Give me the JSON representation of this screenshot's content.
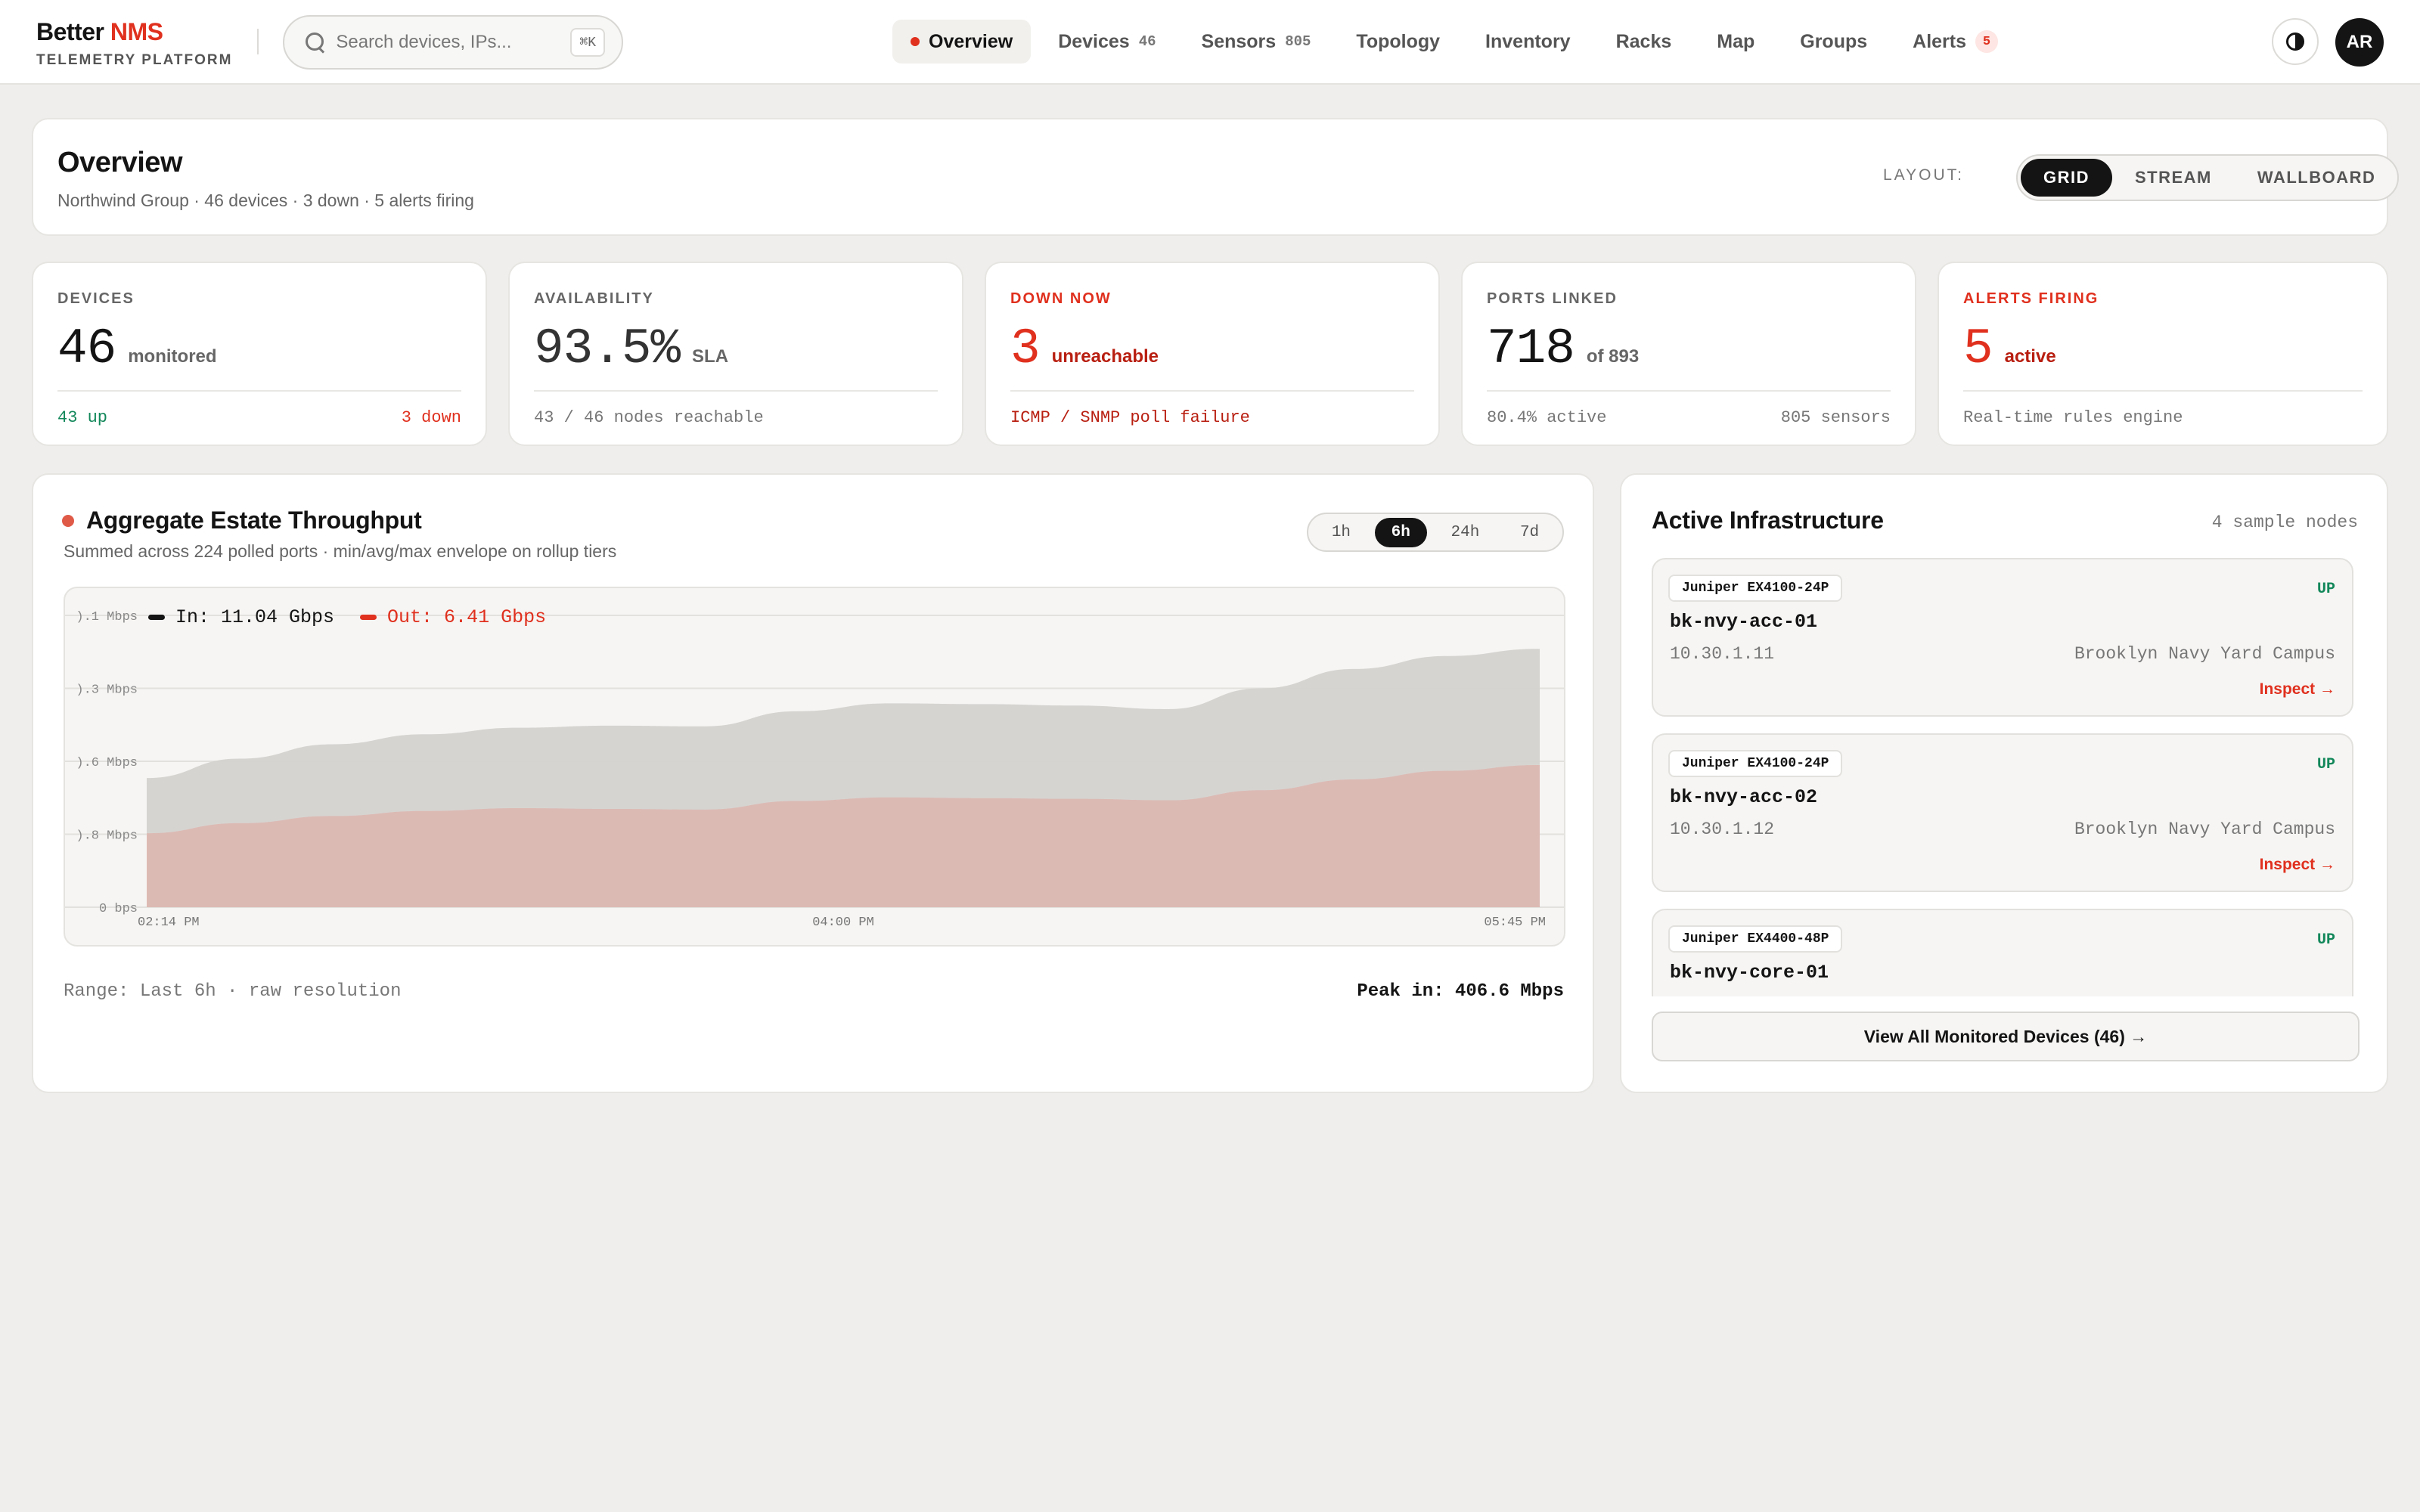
{
  "brand": {
    "name_prefix": "Better",
    "name_accent": "NMS",
    "subtitle": "TELEMETRY PLATFORM"
  },
  "search": {
    "placeholder": "Search devices, IPs...",
    "value": "",
    "shortcut": "⌘K"
  },
  "nav": {
    "items": [
      {
        "label": "Overview",
        "count": ""
      },
      {
        "label": "Devices",
        "count": "46"
      },
      {
        "label": "Sensors",
        "count": "805"
      },
      {
        "label": "Topology",
        "count": ""
      },
      {
        "label": "Inventory",
        "count": ""
      },
      {
        "label": "Racks",
        "count": ""
      },
      {
        "label": "Map",
        "count": ""
      },
      {
        "label": "Groups",
        "count": ""
      },
      {
        "label": "Alerts",
        "count": "5"
      }
    ]
  },
  "user": {
    "initials": "AR"
  },
  "overview": {
    "title": "Overview",
    "subtitle": "Northwind Group · 46 devices · 3 down · 5 alerts firing",
    "layout_label": "LAYOUT:",
    "layouts": [
      "GRID",
      "STREAM",
      "WALLBOARD"
    ],
    "active_layout": "GRID"
  },
  "stats": [
    {
      "label": "DEVICES",
      "value": "46",
      "unit": "monitored",
      "foot_left": "43 up",
      "foot_right": "3 down"
    },
    {
      "label": "AVAILABILITY",
      "value": "93.5%",
      "unit": "SLA",
      "foot_left": "43 / 46 nodes reachable",
      "foot_right": ""
    },
    {
      "label": "DOWN NOW",
      "value": "3",
      "unit": "unreachable",
      "foot_left": "ICMP / SNMP poll failure",
      "foot_right": ""
    },
    {
      "label": "PORTS LINKED",
      "value": "718",
      "unit": "of 893",
      "foot_left": "80.4% active",
      "foot_right": "805 sensors"
    },
    {
      "label": "ALERTS FIRING",
      "value": "5",
      "unit": "active",
      "foot_left": "Real-time rules engine",
      "foot_right": ""
    }
  ],
  "throughput": {
    "title": "Aggregate Estate Throughput",
    "subtitle": "Summed across 224 polled ports · min/avg/max envelope on rollup tiers",
    "ranges": [
      "1h",
      "6h",
      "24h",
      "7d"
    ],
    "active_range": "6h",
    "legend_in": "In: 11.04 Gbps",
    "legend_out": "Out: 6.41 Gbps",
    "footer_left": "Range: Last 6h · raw resolution",
    "footer_right": "Peak in: 406.6 Mbps",
    "colors": {
      "in": "#d4d2cf",
      "out": "#ddb7b0",
      "out_legend": "#e0301e",
      "in_legend": "#141414"
    }
  },
  "chart_data": {
    "type": "area",
    "ytick_labels": [
      ").1 Mbps",
      ").3 Mbps",
      ").6 Mbps",
      ").8 Mbps",
      "0 bps"
    ],
    "xtick_labels": [
      "02:14 PM",
      "04:00 PM",
      "05:45 PM"
    ],
    "ylim": [
      0,
      406.6
    ],
    "series": [
      {
        "name": "In",
        "values": [
          180,
          207,
          227,
          241,
          250,
          253,
          252,
          273,
          284,
          283,
          281,
          276,
          305,
          332,
          350,
          360
        ]
      },
      {
        "name": "Out",
        "values": [
          103,
          117,
          127,
          134,
          138,
          137,
          136,
          148,
          153,
          152,
          151,
          149,
          163,
          178,
          190,
          198
        ]
      }
    ]
  },
  "infrastructure": {
    "title": "Active Infrastructure",
    "count_label": "4 sample nodes",
    "nodes": [
      {
        "model": "Juniper EX4100-24P",
        "status": "UP",
        "name": "bk-nvy-acc-01",
        "ip": "10.30.1.11",
        "site": "Brooklyn Navy Yard Campus",
        "action": "Inspect →"
      },
      {
        "model": "Juniper EX4100-24P",
        "status": "UP",
        "name": "bk-nvy-acc-02",
        "ip": "10.30.1.12",
        "site": "Brooklyn Navy Yard Campus",
        "action": "Inspect →"
      },
      {
        "model": "Juniper EX4400-48P",
        "status": "UP",
        "name": "bk-nvy-core-01",
        "ip": "",
        "site": "",
        "action": ""
      }
    ],
    "view_all": "View All Monitored Devices (46) →"
  }
}
